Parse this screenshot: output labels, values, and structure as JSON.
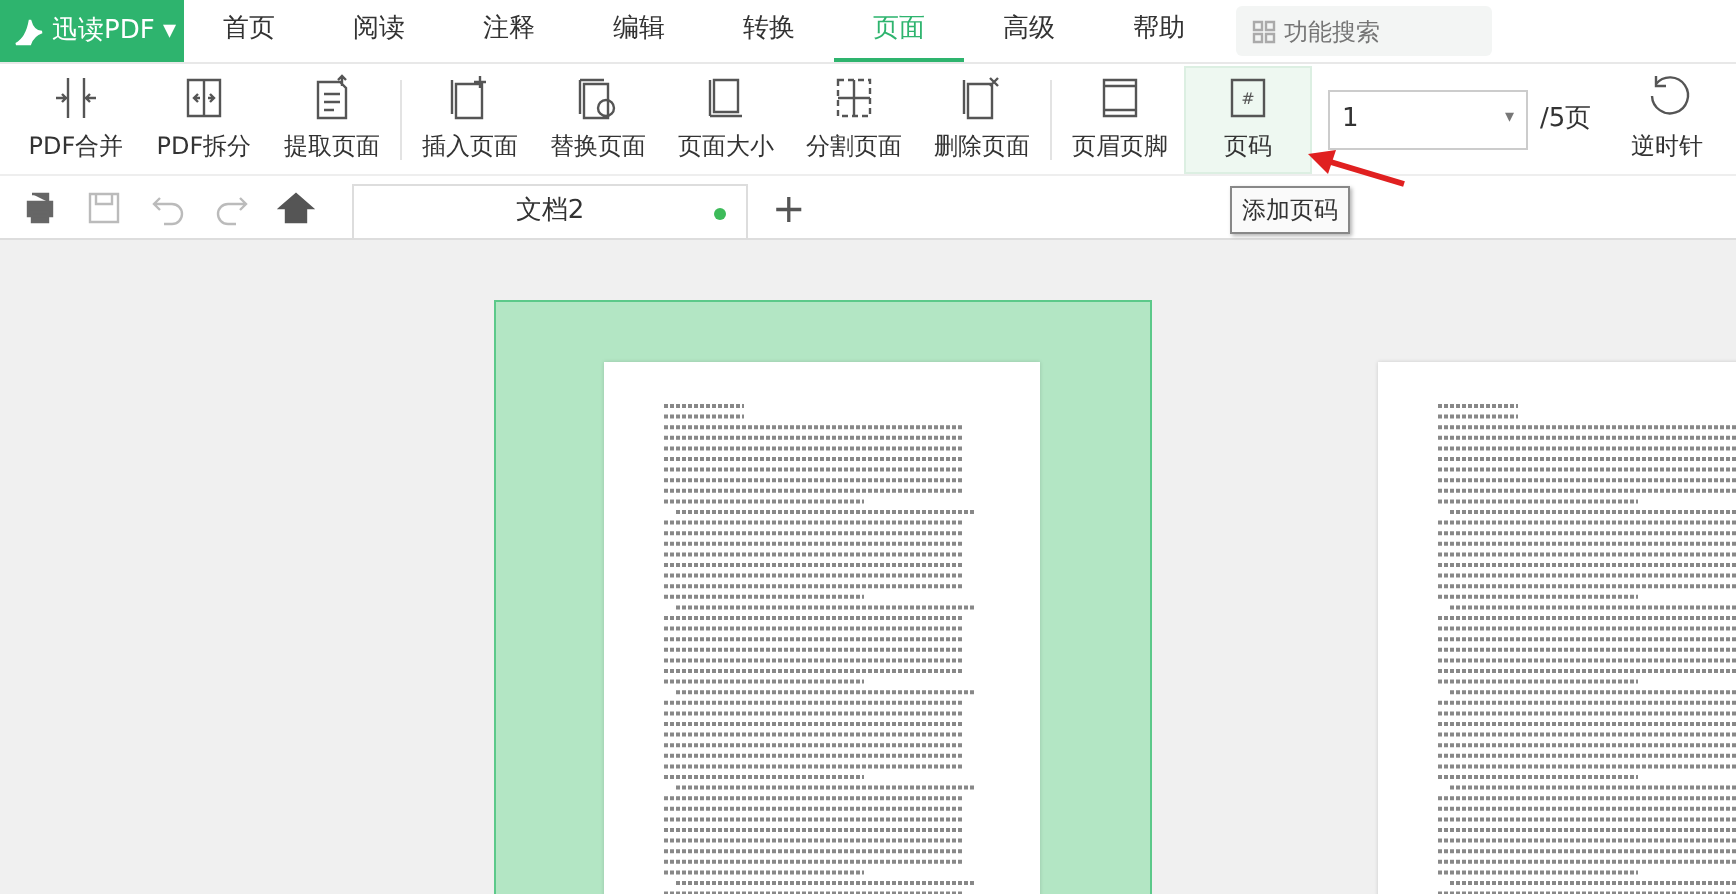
{
  "app_menu": {
    "label": "迅读PDF",
    "caret": "▾"
  },
  "menu_tabs": [
    {
      "label": "首页",
      "selected": false
    },
    {
      "label": "阅读",
      "selected": false
    },
    {
      "label": "注释",
      "selected": false
    },
    {
      "label": "编辑",
      "selected": false
    },
    {
      "label": "转换",
      "selected": false
    },
    {
      "label": "页面",
      "selected": true
    },
    {
      "label": "高级",
      "selected": false
    },
    {
      "label": "帮助",
      "selected": false
    }
  ],
  "search": {
    "placeholder": "功能搜索"
  },
  "ribbon_groups": [
    [
      {
        "label": "PDF合并",
        "selected": false
      },
      {
        "label": "PDF拆分",
        "selected": false
      },
      {
        "label": "提取页面",
        "selected": false
      }
    ],
    [
      {
        "label": "插入页面",
        "selected": false
      },
      {
        "label": "替换页面",
        "selected": false
      },
      {
        "label": "页面大小",
        "selected": false
      },
      {
        "label": "分割页面",
        "selected": false
      },
      {
        "label": "删除页面",
        "selected": false
      }
    ],
    [
      {
        "label": "页眉页脚",
        "selected": false
      },
      {
        "label": "页码",
        "selected": true,
        "icon_text": "#"
      }
    ]
  ],
  "page_selector": {
    "value": "1",
    "caret": "▾",
    "total": "/5页"
  },
  "rotate_button": {
    "label": "逆时针"
  },
  "tooltip": "添加页码",
  "doc_tabs": [
    {
      "label": "文档2",
      "modified": true
    }
  ],
  "new_tab": "+",
  "pages": [
    {
      "selected": true
    },
    {
      "selected": false
    }
  ]
}
